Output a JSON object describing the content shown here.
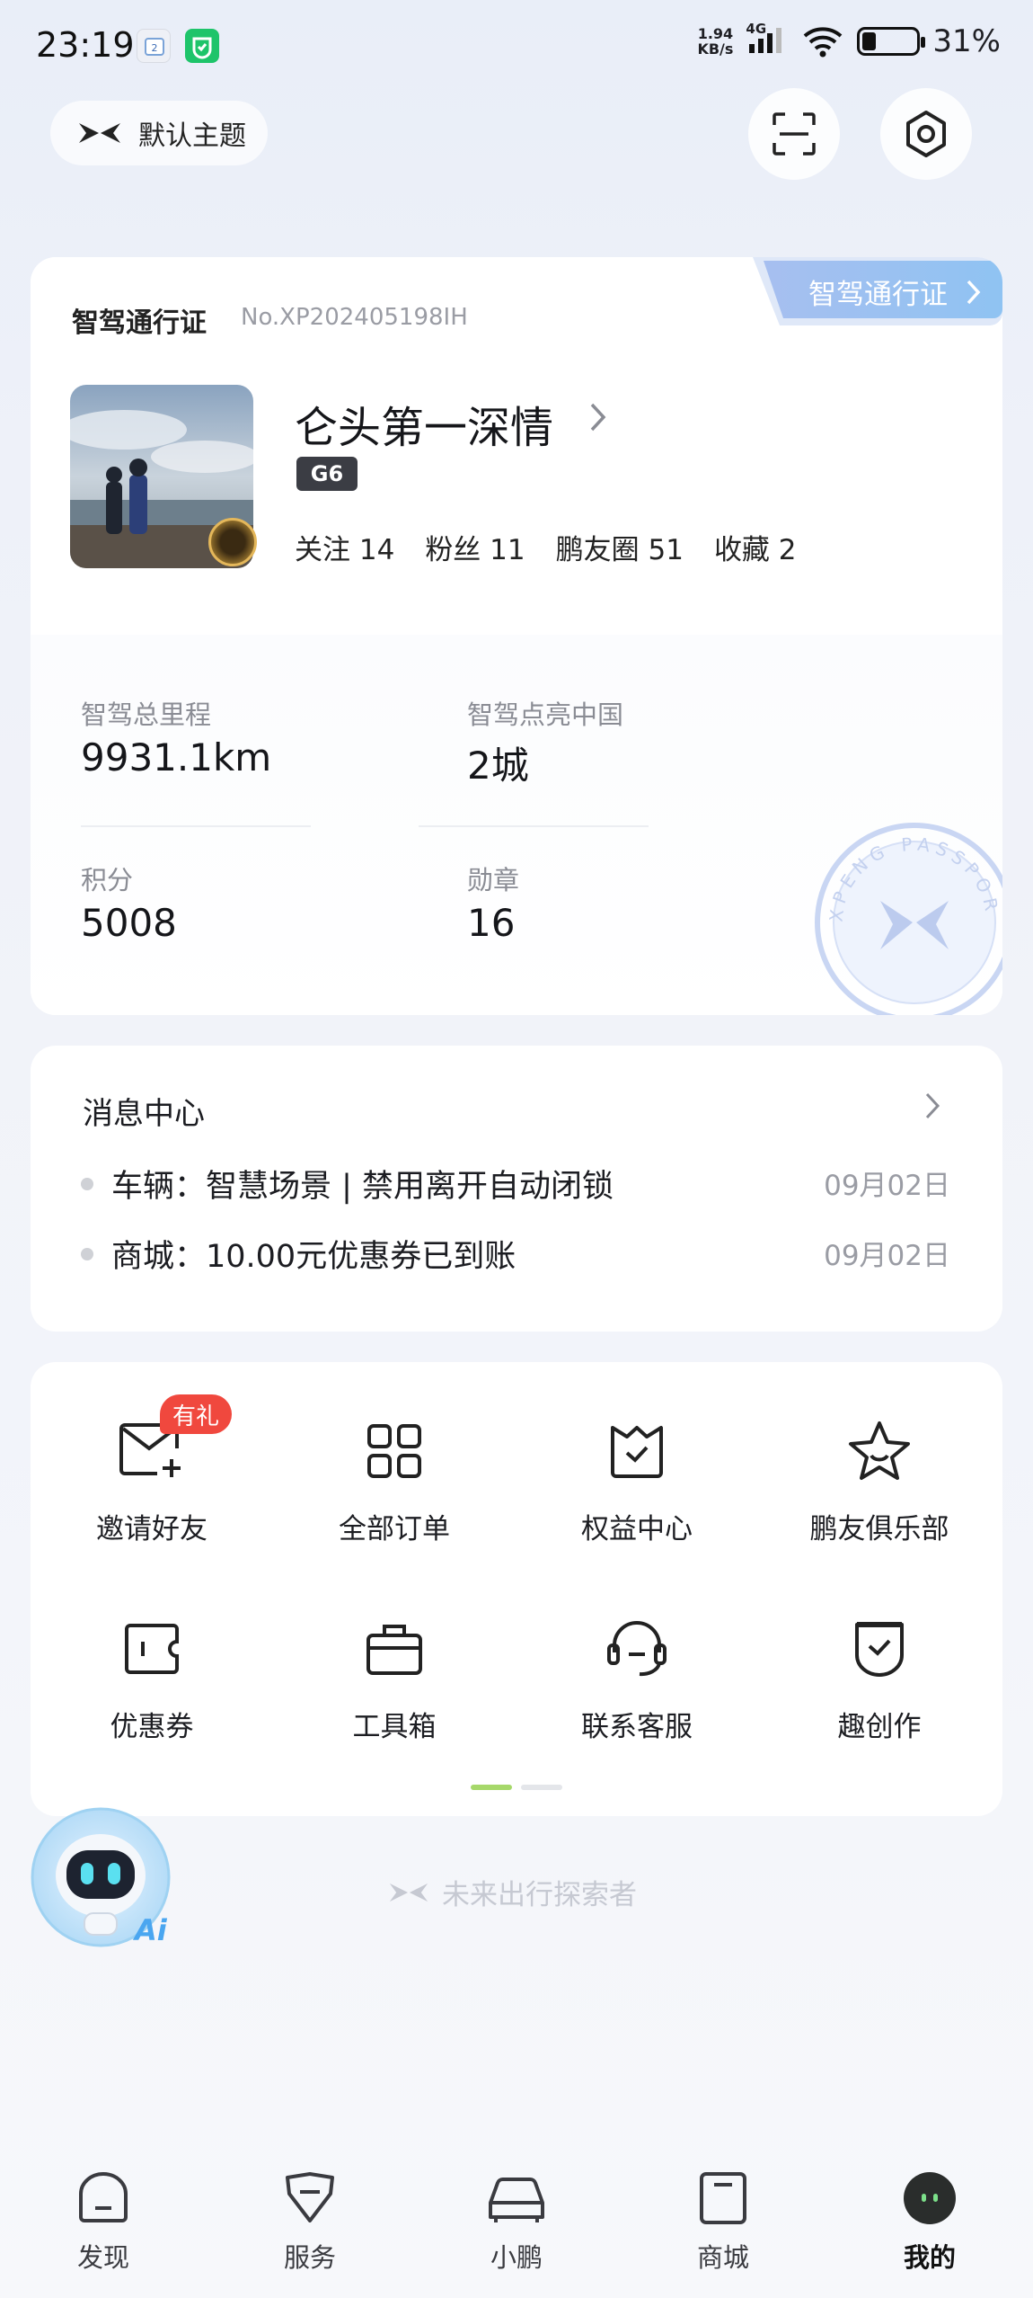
{
  "status_bar": {
    "time": "23:19",
    "net_speed_value": "1.94",
    "net_speed_unit": "KB/s",
    "network": "4G",
    "battery": "31%"
  },
  "header": {
    "theme_label": "默认主题",
    "icons": [
      "xpeng-logo-icon",
      "scan-icon",
      "settings-icon"
    ]
  },
  "passport": {
    "title": "智驾通行证",
    "number": "No.XP202405198IH",
    "tab_label": "智驾通行证",
    "username": "仑头第一深情",
    "car_model": "G6",
    "social": [
      {
        "label": "关注",
        "value": "14"
      },
      {
        "label": "粉丝",
        "value": "11"
      },
      {
        "label": "鹏友圈",
        "value": "51"
      },
      {
        "label": "收藏",
        "value": "2"
      }
    ],
    "stats": {
      "mileage_label": "智驾总里程",
      "mileage_value": "9931.1km",
      "cities_label": "智驾点亮中国",
      "cities_value": "2城",
      "points_label": "积分",
      "points_value": "5008",
      "medals_label": "勋章",
      "medals_value": "16"
    },
    "stamp_text": "XPENG PASSPORT"
  },
  "messages": {
    "title": "消息中心",
    "items": [
      {
        "text": "车辆：智慧场景 | 禁用离开自动闭锁",
        "date": "09月02日"
      },
      {
        "text": "商城：10.00元优惠券已到账",
        "date": "09月02日"
      }
    ]
  },
  "shortcuts": {
    "gift_badge": "有礼",
    "items": [
      {
        "label": "邀请好友",
        "icon": "invite-mail-icon"
      },
      {
        "label": "全部订单",
        "icon": "grid-orders-icon"
      },
      {
        "label": "权益中心",
        "icon": "benefits-crown-icon"
      },
      {
        "label": "鹏友俱乐部",
        "icon": "star-club-icon"
      },
      {
        "label": "优惠券",
        "icon": "coupon-icon"
      },
      {
        "label": "工具箱",
        "icon": "toolbox-icon"
      },
      {
        "label": "联系客服",
        "icon": "headset-icon"
      },
      {
        "label": "趣创作",
        "icon": "create-shield-icon"
      }
    ]
  },
  "ai": {
    "label": "Ai"
  },
  "slogan": "未来出行探索者",
  "tabbar": {
    "items": [
      {
        "label": "发现"
      },
      {
        "label": "服务"
      },
      {
        "label": "小鹏"
      },
      {
        "label": "商城"
      },
      {
        "label": "我的"
      }
    ],
    "active": "我的"
  }
}
